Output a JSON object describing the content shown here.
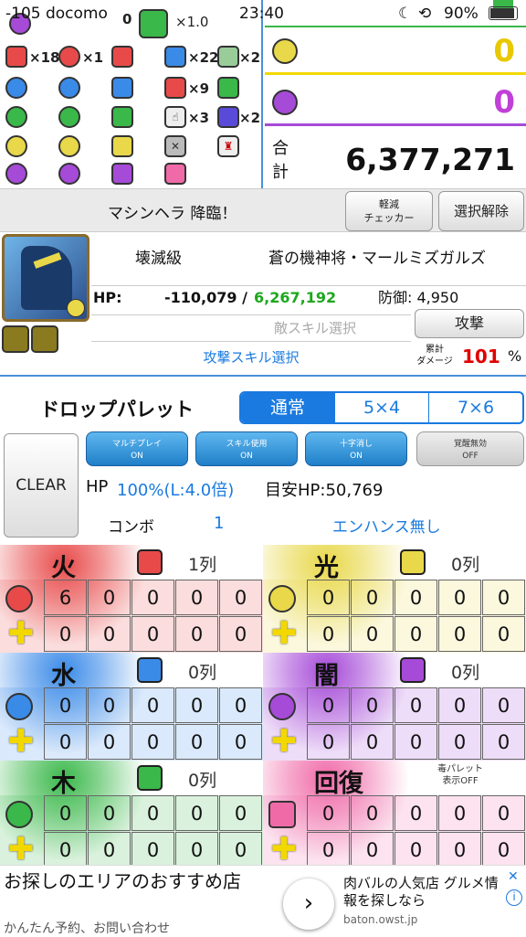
{
  "status_bar": {
    "carrier": "-105 docomo",
    "time": "23:40",
    "battery": "90%"
  },
  "orb_counter": {
    "multiplier": "×1.0",
    "zero": "0",
    "counts": {
      "r1a": "×18",
      "r1b": "×1",
      "r1c": "×22",
      "r1d": "×2",
      "r2a": "×9",
      "r3a": "×3",
      "r3b": "×2"
    }
  },
  "damage": {
    "light": "0",
    "dark": "0",
    "total_label": "合計",
    "total": "6,377,271"
  },
  "skill_bar": {
    "title": "マシンヘラ 降臨！",
    "checker_label": "軽減\nチェッカー",
    "clear_select_label": "選択解除"
  },
  "monster": {
    "difficulty": "壊滅級",
    "name": "蒼の機神将・マールミズガルズ",
    "hp_label": "HP:",
    "hp_current": "-110,079 /",
    "hp_max": "6,267,192",
    "defense": "防御: 4,950",
    "enemy_skill_placeholder": "敵スキル選択",
    "attack_label": "攻撃",
    "attack_skill_label": "攻撃スキル選択",
    "cumulative_label": "累計\nダメージ",
    "cumulative_value": "101",
    "percent": "%"
  },
  "palette": {
    "title": "ドロップパレット",
    "tabs": [
      "通常",
      "5×4",
      "7×6"
    ],
    "selected_tab": "通常",
    "clear_label": "CLEAR",
    "toggles": [
      {
        "label": "マルチプレイ",
        "state": "ON"
      },
      {
        "label": "スキル使用",
        "state": "ON"
      },
      {
        "label": "十字消し",
        "state": "ON"
      },
      {
        "label": "覚醒無効",
        "state": "OFF"
      }
    ],
    "hp_label": "HP",
    "hp_value": "100%(L:4.0倍)",
    "target_hp": "目安HP:50,769",
    "combo_label": "コンボ",
    "combo_value": "1",
    "enhance": "エンハンス無し"
  },
  "attributes": [
    {
      "name": "火",
      "rows": "1列",
      "row1": [
        "6",
        "0",
        "0",
        "0",
        "0"
      ],
      "row2": [
        "0",
        "0",
        "0",
        "0",
        "0"
      ],
      "color": "#e84a4a"
    },
    {
      "name": "光",
      "rows": "0列",
      "row1": [
        "0",
        "0",
        "0",
        "0",
        "0"
      ],
      "row2": [
        "0",
        "0",
        "0",
        "0",
        "0"
      ],
      "color": "#e8d84a"
    },
    {
      "name": "水",
      "rows": "0列",
      "row1": [
        "0",
        "0",
        "0",
        "0",
        "0"
      ],
      "row2": [
        "0",
        "0",
        "0",
        "0",
        "0"
      ],
      "color": "#3a8ae8"
    },
    {
      "name": "闇",
      "rows": "0列",
      "row1": [
        "0",
        "0",
        "0",
        "0",
        "0"
      ],
      "row2": [
        "0",
        "0",
        "0",
        "0",
        "0"
      ],
      "color": "#a64ad8"
    },
    {
      "name": "木",
      "rows": "0列",
      "row1": [
        "0",
        "0",
        "0",
        "0",
        "0"
      ],
      "row2": [
        "0",
        "0",
        "0",
        "0",
        "0"
      ],
      "color": "#3ab84a"
    },
    {
      "name": "回復",
      "rows": "毒パレット\n表示OFF",
      "row1": [
        "0",
        "0",
        "0",
        "0",
        "0"
      ],
      "row2": [
        "0",
        "0",
        "0",
        "0",
        "0"
      ],
      "color": "#f06aa8"
    }
  ],
  "ad": {
    "headline": "お探しのエリアのおすすめ店",
    "sub": "かんたん予約、お問い合わせ",
    "right_text": "肉バルの人気店 グルメ情報を探しなら",
    "domain": "baton.owst.jp"
  },
  "colors": {
    "accent": "#1a7ae0",
    "fire": "#e84a4a",
    "light": "#e8d84a",
    "water": "#3a8ae8",
    "dark": "#a64ad8",
    "wood": "#3ab84a",
    "heart": "#f06aa8",
    "total_red": "#e00000"
  }
}
